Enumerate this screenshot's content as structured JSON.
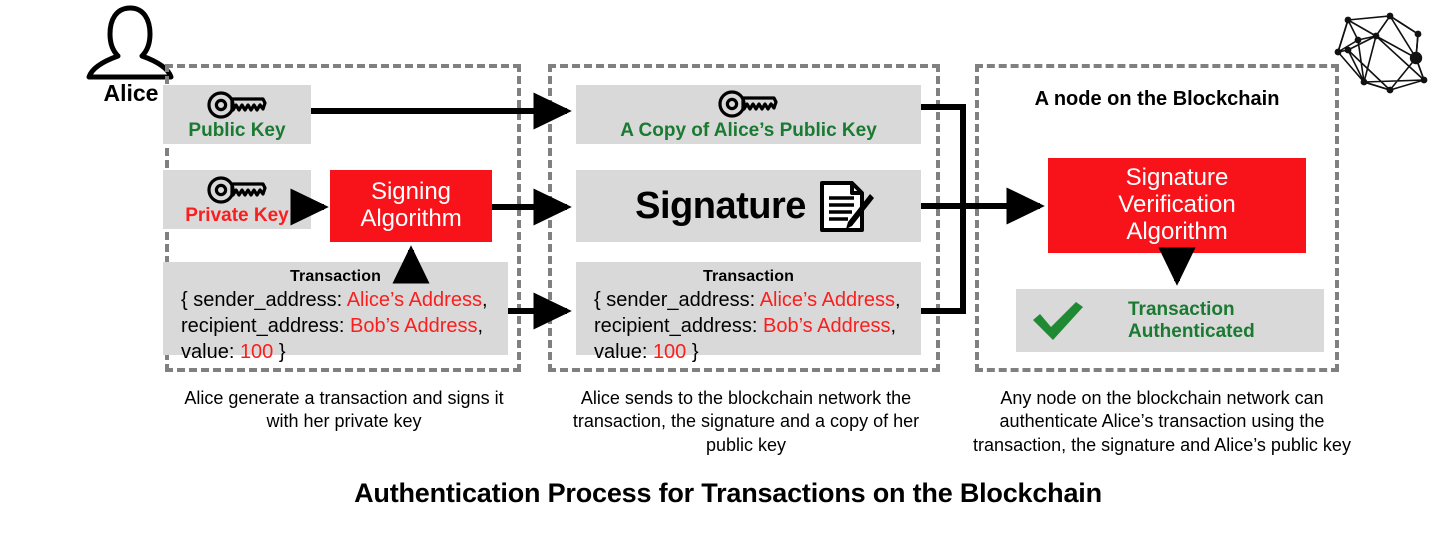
{
  "title": "Authentication Process for Transactions on the Blockchain",
  "actor": {
    "name": "Alice",
    "icon": "person-icon"
  },
  "network_icon": "blockchain-network-icon",
  "colors": {
    "red": "#f8131a",
    "green": "#1b7a32",
    "value_red": "#fa1e1e",
    "gray_box": "#d9d9d9",
    "dashed_border": "#808080",
    "arrow": "#000000"
  },
  "columns": [
    {
      "id": "alice-side",
      "caption": "Alice generate a transaction and signs it with her private key",
      "caption_lines": [
        "Alice generate a transaction and signs it",
        "with her private key"
      ],
      "boxes": {
        "public_key": {
          "label": "Public Key",
          "icon": "key-icon",
          "color": "#1b7a32"
        },
        "private_key": {
          "label": "Private Key",
          "icon": "key-icon",
          "color": "#fa1e1e"
        },
        "signing_algorithm": {
          "line1": "Signing",
          "line2": "Algorithm"
        },
        "transaction": {
          "title": "Transaction",
          "line1_key": "{ sender_address: ",
          "line1_value": "Alice’s Address",
          "line1_tail": ",",
          "line2_key": "recipient_address: ",
          "line2_value": "Bob’s Address",
          "line2_tail": ",",
          "line3_key": "value: ",
          "line3_value": "100",
          "line3_tail": " }"
        }
      }
    },
    {
      "id": "broadcast-side",
      "caption": "Alice sends to the blockchain network the transaction, the signature and a copy of her public key",
      "caption_lines": [
        "Alice sends to the blockchain network the",
        "transaction, the signature and a copy of her",
        "public key"
      ],
      "boxes": {
        "public_key_copy": {
          "label": "A Copy of Alice’s Public Key",
          "icon": "key-icon",
          "color": "#1b7a32"
        },
        "signature": {
          "label": "Signature",
          "icon": "signed-document-icon"
        },
        "transaction": {
          "title": "Transaction",
          "line1_key": "{ sender_address: ",
          "line1_value": "Alice’s Address",
          "line1_tail": ",",
          "line2_key": "recipient_address: ",
          "line2_value": "Bob’s Address",
          "line2_tail": ",",
          "line3_key": "value: ",
          "line3_value": "100",
          "line3_tail": " }"
        }
      }
    },
    {
      "id": "node-side",
      "heading": "A node on the Blockchain",
      "caption": "Any node on the blockchain network can authenticate Alice’s transaction using the transaction, the signature and Alice’s public key",
      "caption_lines": [
        "Any node on the blockchain network can",
        "authenticate Alice’s transaction using the",
        "transaction, the signature and Alice’s public key"
      ],
      "boxes": {
        "verification_algorithm": {
          "line1": "Signature",
          "line2": "Verification",
          "line3": "Algorithm"
        },
        "result": {
          "label": "Transaction Authenticated",
          "icon": "green-check-icon",
          "color": "#1b7a32"
        }
      }
    }
  ]
}
